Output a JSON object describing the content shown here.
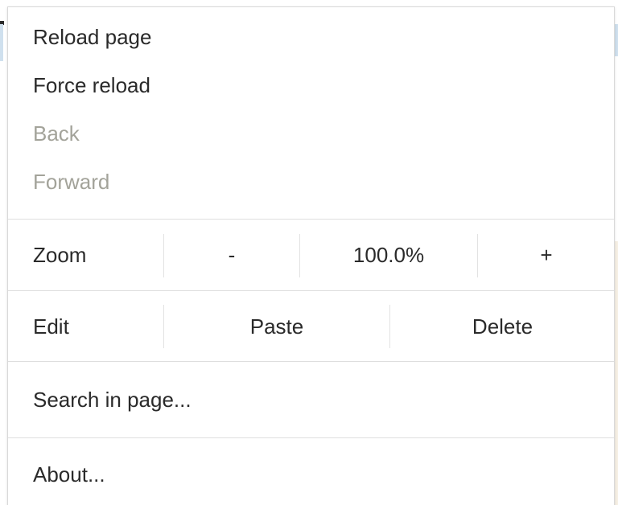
{
  "menu": {
    "reload": "Reload page",
    "force_reload": "Force reload",
    "back": "Back",
    "forward": "Forward",
    "zoom": {
      "label": "Zoom",
      "decrease": "-",
      "level": "100.0%",
      "increase": "+"
    },
    "edit": {
      "label": "Edit",
      "paste": "Paste",
      "delete": "Delete"
    },
    "search": "Search in page...",
    "about": "About..."
  }
}
